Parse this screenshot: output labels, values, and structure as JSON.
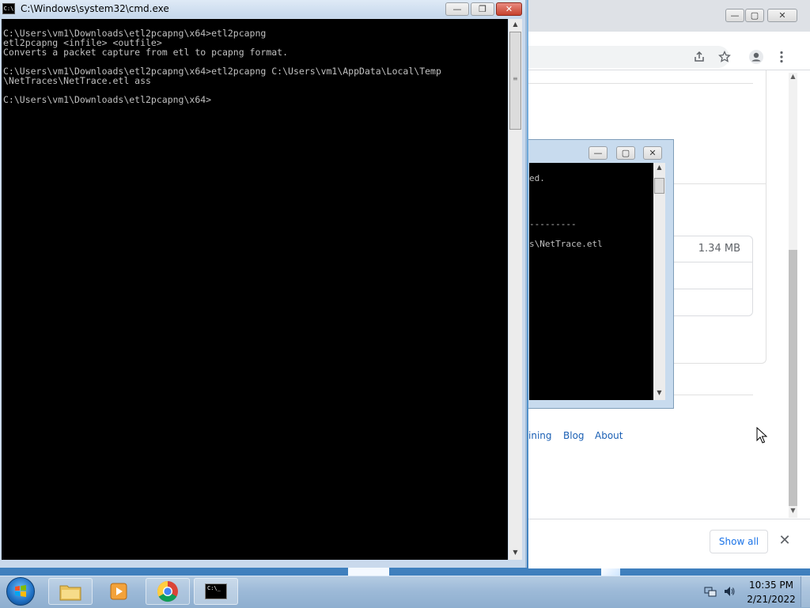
{
  "cmd": {
    "title": "C:\\Windows\\system32\\cmd.exe",
    "app_icon_text": "C:\\",
    "lines": [
      "",
      "C:\\Users\\vm1\\Downloads\\etl2pcapng\\x64>etl2pcapng",
      "etl2pcapng <infile> <outfile>",
      "Converts a packet capture from etl to pcapng format.",
      "",
      "C:\\Users\\vm1\\Downloads\\etl2pcapng\\x64>etl2pcapng C:\\Users\\vm1\\AppData\\Local\\Temp",
      "\\NetTraces\\NetTrace.etl ass",
      "",
      "C:\\Users\\vm1\\Downloads\\etl2pcapng\\x64>"
    ],
    "minimize": "🗕",
    "maximize": "🗗",
    "close": "✕"
  },
  "cmd2": {
    "line1": "ed.",
    "line2": "---------",
    "line3": "s\\NetTrace.etl"
  },
  "browser": {
    "file_size": "1.34 MB",
    "footer_links": [
      "ining",
      "Blog",
      "About"
    ],
    "show_all": "Show all",
    "shelf_close": "✕"
  },
  "icons": {
    "share": "share-icon",
    "star": "star-icon",
    "profile": "profile-icon",
    "menu": "kebab-menu-icon"
  },
  "taskbar": {
    "time": "10:35 PM",
    "date": "2/21/2022",
    "cmd_icon_text": "C:\\_"
  },
  "colors": {
    "console_bg": "#000000",
    "console_text": "#c0c0c0",
    "link": "#1a5fb4",
    "chrome_accent": "#1a73e8"
  }
}
